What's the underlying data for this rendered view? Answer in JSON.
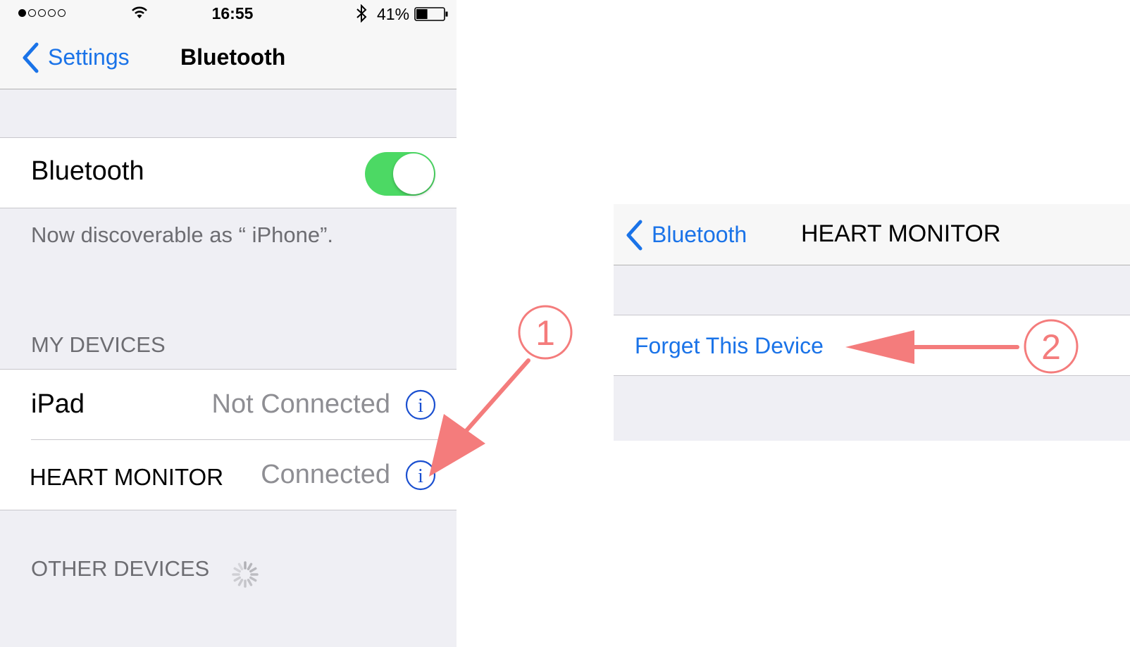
{
  "status_bar": {
    "time": "16:55",
    "battery_percent": "41%",
    "signal_dots_filled": 1,
    "signal_dots_total": 5,
    "battery_level": 0.41
  },
  "settings_screen": {
    "back_label": "Settings",
    "title": "Bluetooth",
    "bluetooth_row": {
      "label": "Bluetooth",
      "toggle_on": true
    },
    "discoverable_text": "Now discoverable as “ iPhone”.",
    "my_devices_header": "MY DEVICES",
    "devices": [
      {
        "name": "iPad",
        "status": "Not Connected"
      },
      {
        "name": "HEART MONITOR",
        "status": "Connected"
      }
    ],
    "other_devices_header": "OTHER DEVICES"
  },
  "detail_screen": {
    "back_label": "Bluetooth",
    "title": "HEART MONITOR",
    "forget_label": "Forget This Device"
  },
  "annotations": {
    "step1_label": "1",
    "step2_label": "2",
    "color": "#f47c7c"
  },
  "colors": {
    "accent": "#1a73e8",
    "toggle_on": "#4cd964",
    "group_bg": "#efeff4",
    "secondary_text": "#6d6d72",
    "status_text": "#8e8e93"
  },
  "icons": {
    "signal": "signal-dots-icon",
    "wifi": "wifi-icon",
    "bluetooth": "bluetooth-icon",
    "battery": "battery-icon",
    "back": "chevron-left-icon",
    "info": "info-circle-icon",
    "spinner": "activity-spinner-icon"
  }
}
